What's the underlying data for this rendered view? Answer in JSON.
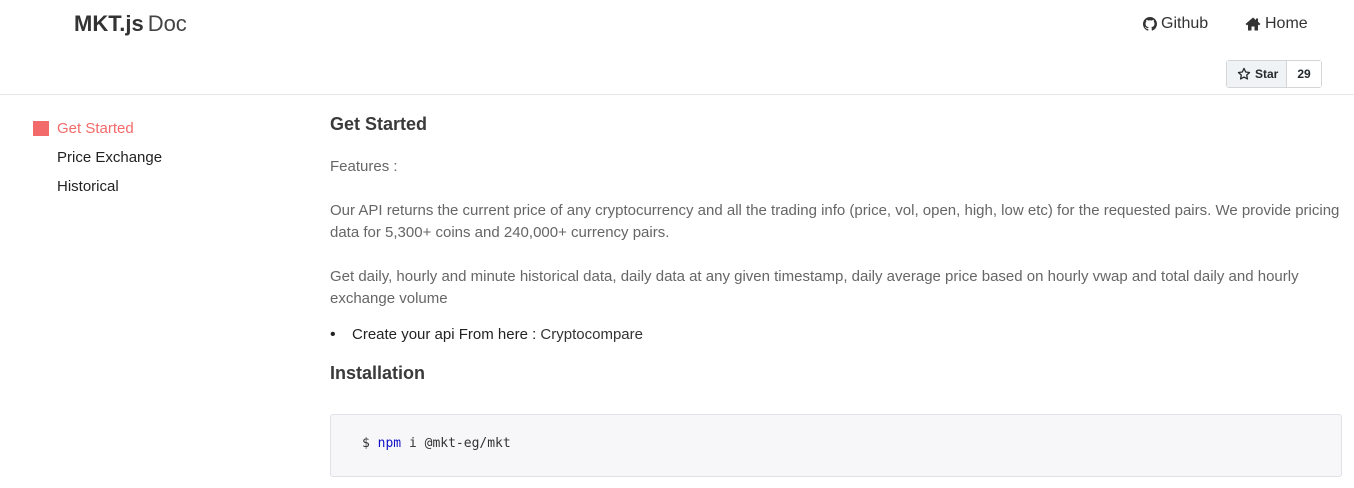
{
  "header": {
    "brand_strong": "MKT.js",
    "brand_light": "Doc",
    "nav": [
      {
        "label": "Github",
        "icon": "github-icon"
      },
      {
        "label": "Home",
        "icon": "home-icon"
      }
    ],
    "star": {
      "label": "Star",
      "count": "29"
    }
  },
  "sidebar": {
    "items": [
      {
        "label": "Get Started",
        "active": true
      },
      {
        "label": "Price Exchange",
        "active": false
      },
      {
        "label": "Historical",
        "active": false
      }
    ]
  },
  "main": {
    "title": "Get Started",
    "features_label": "Features :",
    "paragraph1": "Our API returns the current price of any cryptocurrency and all the trading info (price, vol, open, high, low etc) for the requested pairs. We provide pricing data for 5,300+ coins and 240,000+ currency pairs.",
    "paragraph2": "Get daily, hourly and minute historical data, daily data at any given timestamp, daily average price based on hourly vwap and total daily and hourly exchange volume",
    "bullet_text": "Create your api From here : ",
    "bullet_link": "Cryptocompare",
    "install_title": "Installation",
    "code": {
      "prompt": "$ ",
      "command": "npm",
      "args": " i @mkt-eg/mkt"
    }
  },
  "colors": {
    "accent": "#f26a6a",
    "code_keyword": "#1111c8"
  }
}
